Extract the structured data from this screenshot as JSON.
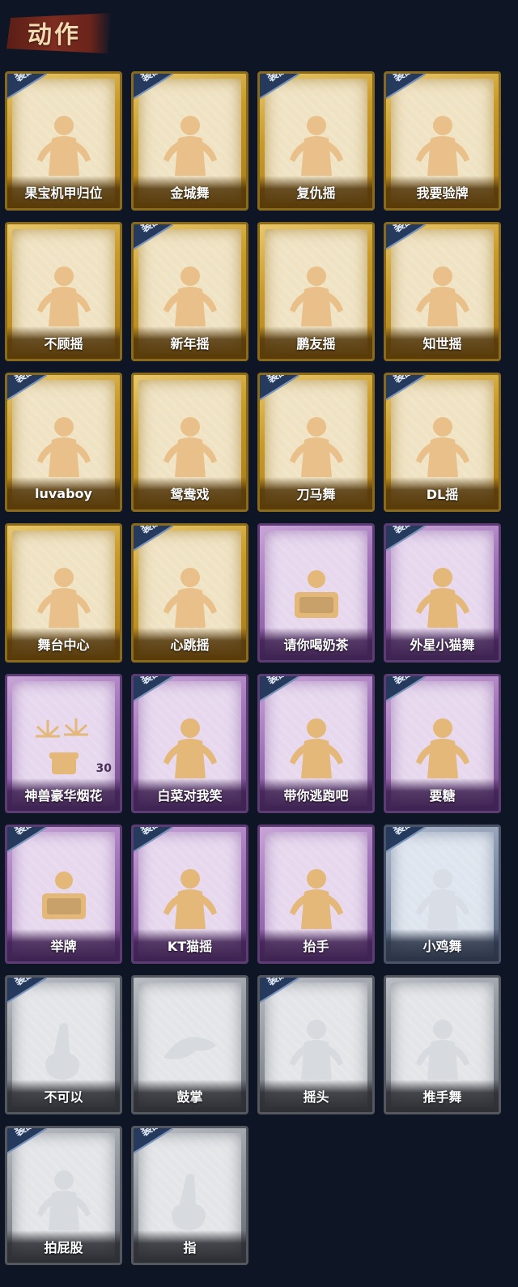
{
  "header": {
    "title": "动作"
  },
  "equip_label": "装配",
  "cards": [
    {
      "label": "果宝机甲归位",
      "equipped": true,
      "rarity": "gold",
      "icon": "dancer-pose-icon"
    },
    {
      "label": "金城舞",
      "equipped": true,
      "rarity": "gold",
      "icon": "dancer-pose-icon"
    },
    {
      "label": "复仇摇",
      "equipped": true,
      "rarity": "gold",
      "icon": "dancer-pose-icon"
    },
    {
      "label": "我要验牌",
      "equipped": true,
      "rarity": "gold",
      "icon": "dancer-pose-icon"
    },
    {
      "label": "不顾摇",
      "equipped": false,
      "rarity": "gold",
      "icon": "dancer-pose-icon"
    },
    {
      "label": "新年摇",
      "equipped": true,
      "rarity": "gold",
      "icon": "dancer-pose-icon"
    },
    {
      "label": "鹏友摇",
      "equipped": false,
      "rarity": "gold",
      "icon": "dancer-pose-icon"
    },
    {
      "label": "知世摇",
      "equipped": true,
      "rarity": "gold",
      "icon": "dancer-pose-icon"
    },
    {
      "label": "luvaboy",
      "equipped": true,
      "rarity": "gold",
      "icon": "dancer-pose-icon"
    },
    {
      "label": "鸳鸯戏",
      "equipped": false,
      "rarity": "gold",
      "icon": "dancer-pose-icon"
    },
    {
      "label": "刀马舞",
      "equipped": true,
      "rarity": "gold",
      "icon": "dancer-pose-icon"
    },
    {
      "label": "DL摇",
      "equipped": true,
      "rarity": "gold",
      "icon": "dancer-pose-icon"
    },
    {
      "label": "舞台中心",
      "equipped": false,
      "rarity": "gold",
      "icon": "dancer-pose-icon"
    },
    {
      "label": "心跳摇",
      "equipped": true,
      "rarity": "gold",
      "icon": "dancer-pose-icon"
    },
    {
      "label": "请你喝奶茶",
      "equipped": false,
      "rarity": "purple",
      "icon": "sign-holder-icon"
    },
    {
      "label": "外星小猫舞",
      "equipped": true,
      "rarity": "purple",
      "icon": "dancer-pose-icon"
    },
    {
      "label": "神兽豪华烟花",
      "equipped": false,
      "rarity": "purple",
      "icon": "fireworks-icon",
      "count": "30"
    },
    {
      "label": "白菜对我笑",
      "equipped": true,
      "rarity": "purple",
      "icon": "dancer-pose-icon"
    },
    {
      "label": "带你逃跑吧",
      "equipped": true,
      "rarity": "purple",
      "icon": "dancer-pose-icon"
    },
    {
      "label": "要糖",
      "equipped": true,
      "rarity": "purple",
      "icon": "silver-figure-icon"
    },
    {
      "label": "举牌",
      "equipped": true,
      "rarity": "purple",
      "icon": "sign-holder-icon"
    },
    {
      "label": "KT猫摇",
      "equipped": true,
      "rarity": "purple",
      "icon": "dancer-pose-icon"
    },
    {
      "label": "抬手",
      "equipped": false,
      "rarity": "purple",
      "icon": "silver-figure-icon"
    },
    {
      "label": "小鸡舞",
      "equipped": true,
      "rarity": "blue",
      "icon": "silver-figure-icon"
    },
    {
      "label": "不可以",
      "equipped": true,
      "rarity": "grey",
      "icon": "finger-wag-icon"
    },
    {
      "label": "鼓掌",
      "equipped": false,
      "rarity": "grey",
      "icon": "clap-hands-icon"
    },
    {
      "label": "摇头",
      "equipped": true,
      "rarity": "grey",
      "icon": "silver-figure-icon"
    },
    {
      "label": "推手舞",
      "equipped": false,
      "rarity": "grey",
      "icon": "silver-figure-icon"
    },
    {
      "label": "拍屁股",
      "equipped": true,
      "rarity": "grey",
      "icon": "silver-figure-icon"
    },
    {
      "label": "指",
      "equipped": true,
      "rarity": "grey",
      "icon": "pointing-hand-icon"
    }
  ]
}
